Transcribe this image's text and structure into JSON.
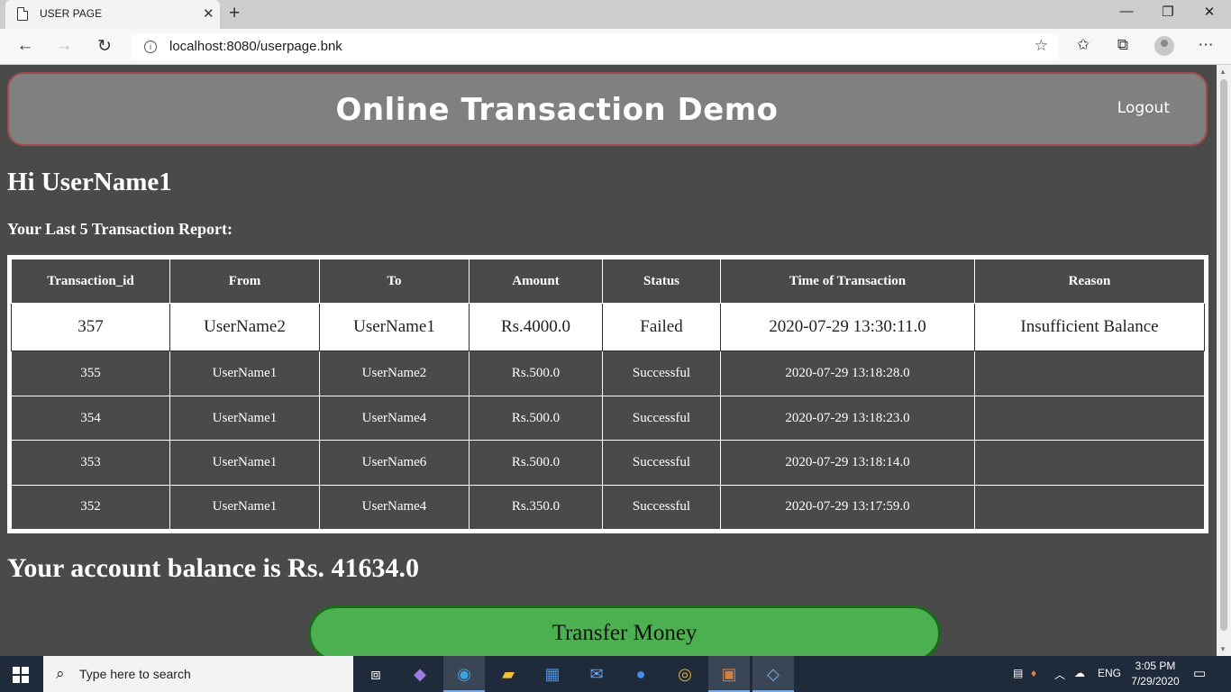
{
  "browser": {
    "tab_title": "USER PAGE",
    "url": "localhost:8080/userpage.bnk"
  },
  "page": {
    "site_title": "Online Transaction Demo",
    "logout_label": "Logout",
    "greeting": "Hi UserName1",
    "report_label": "Your Last 5 Transaction Report:",
    "table": {
      "headers": [
        "Transaction_id",
        "From",
        "To",
        "Amount",
        "Status",
        "Time of Transaction",
        "Reason"
      ],
      "rows": [
        [
          "357",
          "UserName2",
          "UserName1",
          "Rs.4000.0",
          "Failed",
          "2020-07-29 13:30:11.0",
          "Insufficient Balance"
        ],
        [
          "355",
          "UserName1",
          "UserName2",
          "Rs.500.0",
          "Successful",
          "2020-07-29 13:18:28.0",
          ""
        ],
        [
          "354",
          "UserName1",
          "UserName4",
          "Rs.500.0",
          "Successful",
          "2020-07-29 13:18:23.0",
          ""
        ],
        [
          "353",
          "UserName1",
          "UserName6",
          "Rs.500.0",
          "Successful",
          "2020-07-29 13:18:14.0",
          ""
        ],
        [
          "352",
          "UserName1",
          "UserName4",
          "Rs.350.0",
          "Successful",
          "2020-07-29 13:17:59.0",
          ""
        ]
      ]
    },
    "balance_text": "Your account balance is Rs. 41634.0",
    "transfer_label": "Transfer Money"
  },
  "taskbar": {
    "search_placeholder": "Type here to search",
    "language": "ENG",
    "time": "3:05 PM",
    "date": "7/29/2020"
  },
  "colors": {
    "page_bg": "#4a4a4a",
    "header_bg": "#808080",
    "header_border": "#a04a4a",
    "button_green": "#4caf50"
  }
}
